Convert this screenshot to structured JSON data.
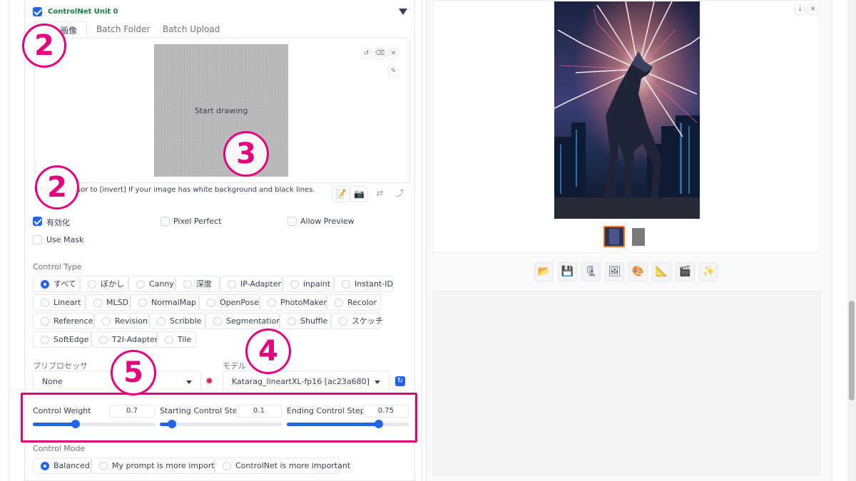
{
  "unit": {
    "title": "ControlNet Unit 0",
    "enabled": true
  },
  "tabs": [
    "単一画像",
    "Batch Folder",
    "Batch Upload"
  ],
  "canvas": {
    "placeholder": "Start drawing"
  },
  "hint": "Invert colors if your image has white background and black lines. Set the preprocessor to [invert] If your image has white background and black lines.",
  "hint_visible": "t the  processor to [invert] If your image has white background and black lines.",
  "options": {
    "enable_label": "有効化",
    "enable": true,
    "pixel_perfect_label": "Pixel Perfect",
    "pixel_perfect": false,
    "allow_preview_label": "Allow Preview",
    "allow_preview": false,
    "use_mask_label": "Use Mask",
    "use_mask": false
  },
  "control_type": {
    "label": "Control Type",
    "selected": "すべて",
    "rows": [
      [
        "すべて",
        "ぼかし",
        "Canny",
        "深度",
        "IP-Adapter",
        "inpaint",
        "Instant-ID"
      ],
      [
        "Lineart",
        "MLSD",
        "NormalMap",
        "OpenPose",
        "PhotoMaker",
        "Recolor"
      ],
      [
        "Reference",
        "Revision",
        "Scribble",
        "Segmentation",
        "Shuffle",
        "スケッチ"
      ],
      [
        "SoftEdge",
        "T2I-Adapter",
        "Tile"
      ]
    ]
  },
  "preprocessor": {
    "label": "プリプロセッサ",
    "value": "None"
  },
  "model": {
    "label": "モデル",
    "value": "Katarag_lineartXL-fp16 [ac23a680]"
  },
  "sliders": [
    {
      "label": "Control Weight",
      "value": "0.7",
      "fraction": 0.35
    },
    {
      "label": "Starting Control Step",
      "value": "0.1",
      "fraction": 0.1
    },
    {
      "label": "Ending Control Step",
      "value": "0.75",
      "fraction": 0.75
    }
  ],
  "control_mode": {
    "label": "Control Mode",
    "selected": "Balanced",
    "options": [
      "Balanced",
      "My prompt is more important",
      "ControlNet is more important"
    ]
  },
  "callouts": [
    "2",
    "2",
    "3",
    "4",
    "5"
  ],
  "colors": {
    "accent": "#2563eb",
    "callout": "#e6007e"
  },
  "toolbar_icons": [
    "folder-icon",
    "save-icon",
    "zip-icon",
    "image-icon",
    "palette-icon",
    "ruler-icon",
    "clapper-icon",
    "sparkle-icon"
  ]
}
